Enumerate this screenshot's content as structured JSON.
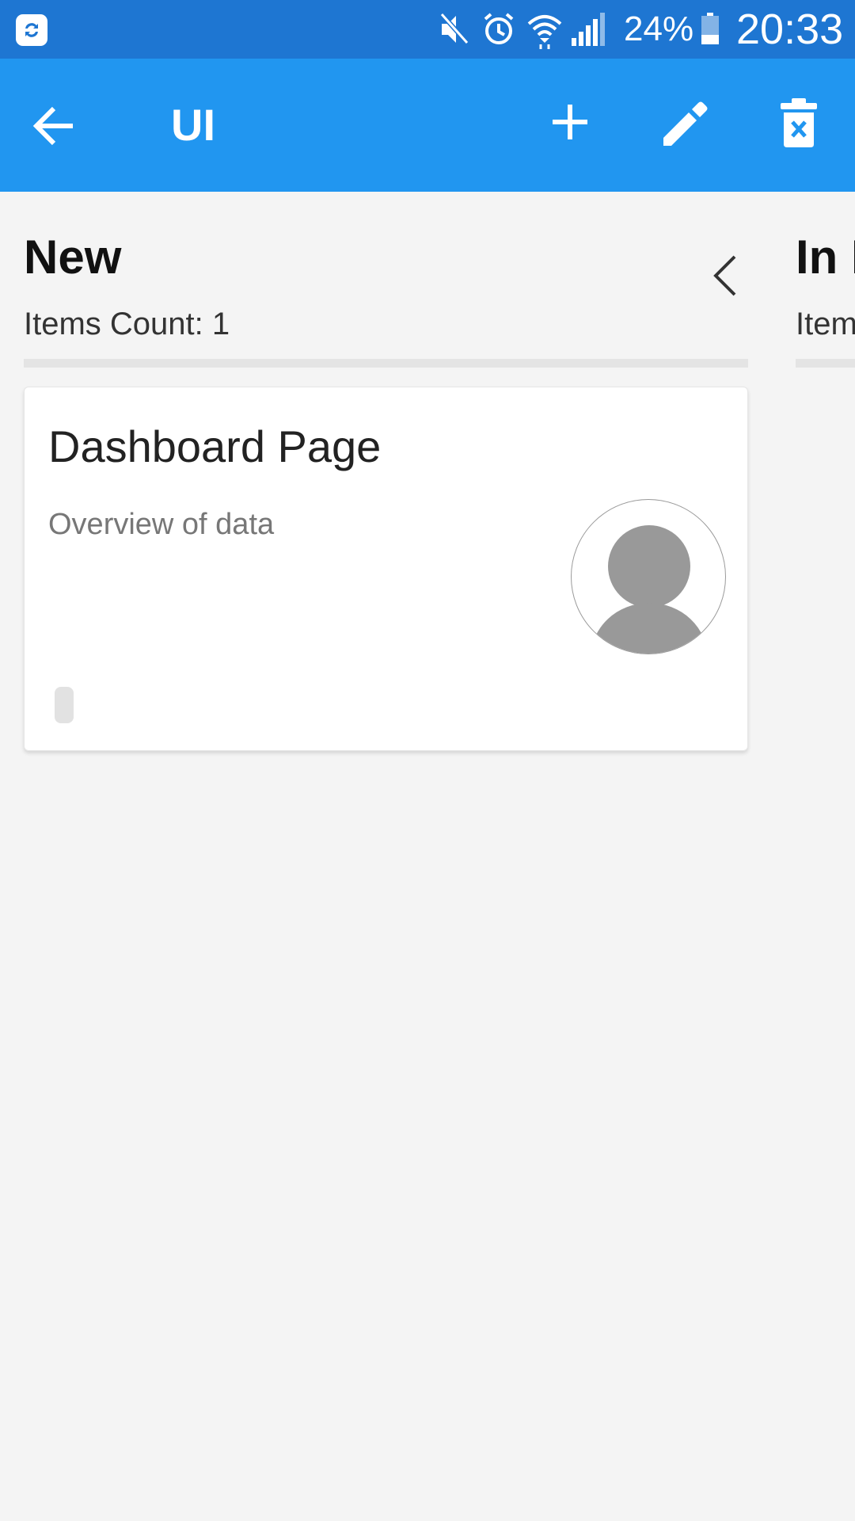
{
  "status_bar": {
    "battery_percent": "24%",
    "time": "20:33",
    "icons": [
      "sync-app-icon",
      "mute-icon",
      "alarm-icon",
      "wifi-icon",
      "signal-icon",
      "battery-icon"
    ]
  },
  "app_bar": {
    "title": "UI",
    "actions": [
      "back-arrow-icon",
      "plus-icon",
      "pencil-icon",
      "delete-icon"
    ]
  },
  "columns": [
    {
      "title": "New",
      "count_label": "Items Count: 1",
      "cards": [
        {
          "title": "Dashboard Page",
          "description": "Overview of data"
        }
      ]
    },
    {
      "title": "In P",
      "count_label": "Item"
    }
  ],
  "colors": {
    "status_bar": "#1e76d2",
    "app_bar": "#2196f0",
    "background": "#f4f4f4",
    "card": "#ffffff",
    "avatar_fill": "#999999"
  }
}
